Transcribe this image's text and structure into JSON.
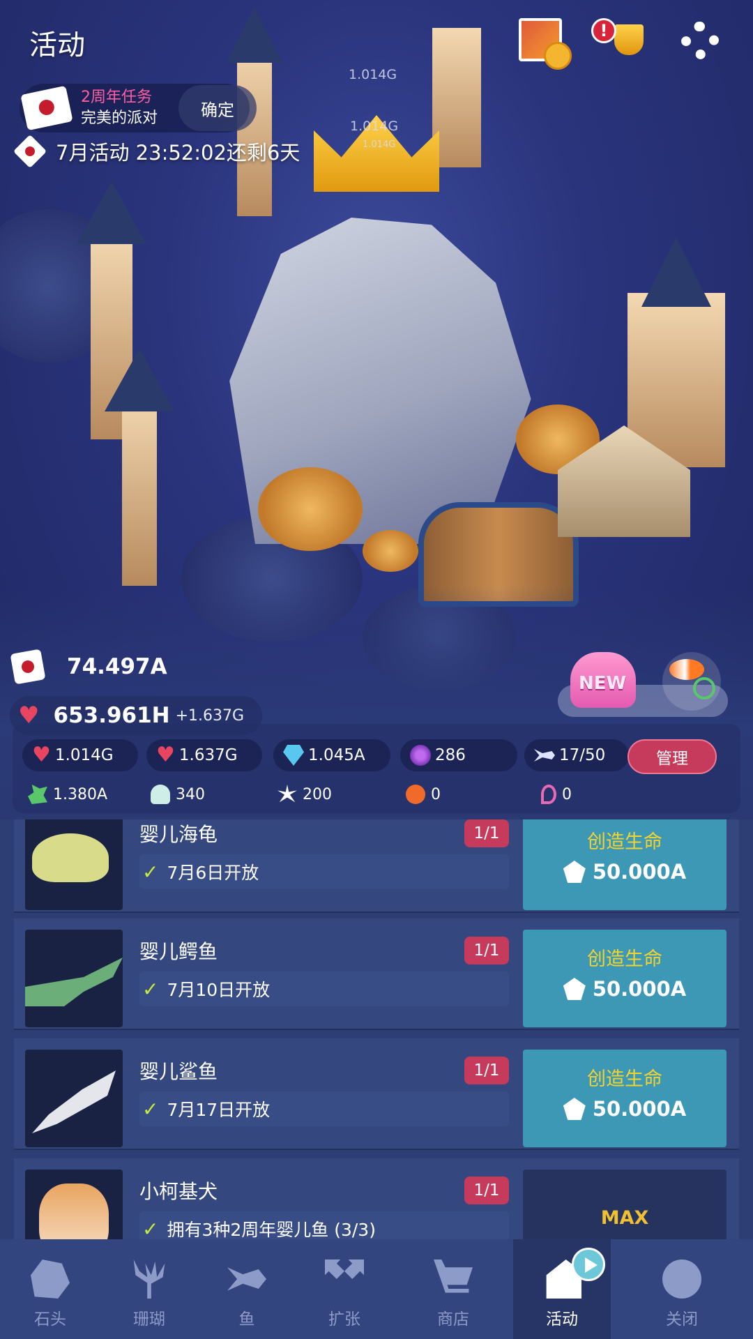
{
  "header": {
    "title": "活动",
    "gallery_icon": "gallery-fish-photo-icon",
    "trophy_alert": "!",
    "settings_icon": "gear-icon"
  },
  "quest": {
    "title": "2周年任务",
    "subtitle": "完美的派对",
    "confirm_label": "确定"
  },
  "event_timer": "7月活动 23:52:02还剩6天",
  "floating_values": [
    "1.014G",
    "1.014G",
    "1.014G"
  ],
  "currency": {
    "event_tokens": "74.497A",
    "hearts": "653.961H",
    "hearts_rate": "+1.637G"
  },
  "new_badge": "NEW",
  "stats": {
    "heart_rate": "1.014G",
    "heart_tap": "1.637G",
    "gems": "1.045A",
    "pearls": "286",
    "fish_count": "17/50",
    "manage_label": "管理",
    "plants": "1.380A",
    "shells": "340",
    "urchins": "200",
    "crabs": "0",
    "seahorses": "0"
  },
  "list": {
    "rows": [
      {
        "name": "婴儿海龟",
        "count": "1/1",
        "condition": "7月6日开放",
        "action_label": "创造生命",
        "price": "50.000A",
        "max": false
      },
      {
        "name": "婴儿鳄鱼",
        "count": "1/1",
        "condition": "7月10日开放",
        "action_label": "创造生命",
        "price": "50.000A",
        "max": false
      },
      {
        "name": "婴儿鲨鱼",
        "count": "1/1",
        "condition": "7月17日开放",
        "action_label": "创造生命",
        "price": "50.000A",
        "max": false
      },
      {
        "name": "小柯基犬",
        "count": "1/1",
        "condition": "拥有3种2周年婴儿鱼 (3/3)",
        "action_label": "MAX",
        "price": "",
        "max": true
      }
    ]
  },
  "nav": {
    "items": [
      {
        "label": "石头",
        "icon": "stone-icon"
      },
      {
        "label": "珊瑚",
        "icon": "coral-icon"
      },
      {
        "label": "鱼",
        "icon": "fish-icon"
      },
      {
        "label": "扩张",
        "icon": "expand-icon"
      },
      {
        "label": "商店",
        "icon": "cart-icon"
      },
      {
        "label": "活动",
        "icon": "event-icon",
        "active": true
      },
      {
        "label": "关闭",
        "icon": "close-arrow-icon"
      }
    ]
  },
  "colors": {
    "accent_pink": "#c63a5c",
    "button_teal": "#3c98b4",
    "gold_text": "#f5d32e",
    "check_green": "#c8ea3a"
  }
}
